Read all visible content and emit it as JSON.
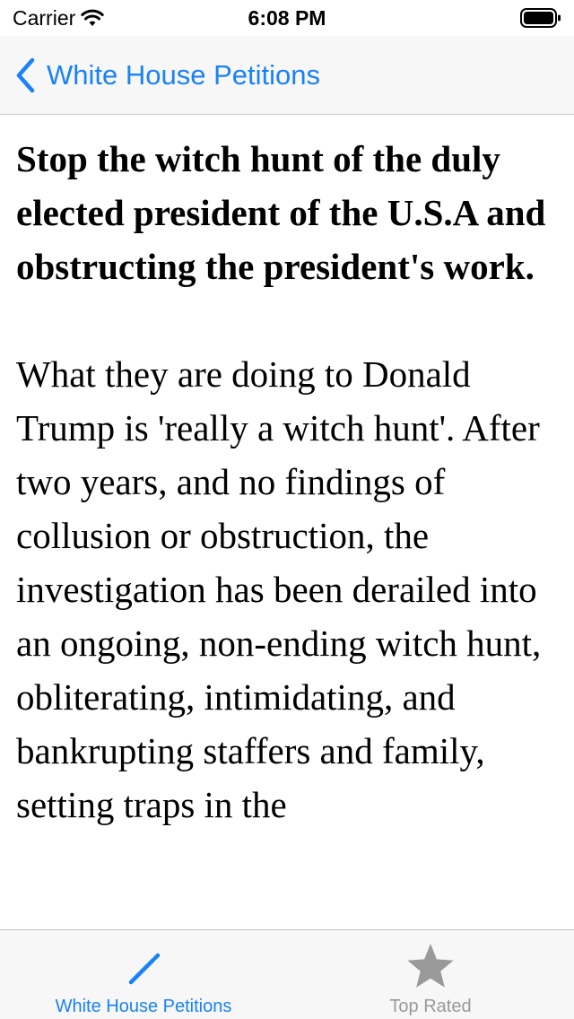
{
  "status_bar": {
    "carrier": "Carrier",
    "time": "6:08 PM",
    "wifi_icon": "wifi-icon",
    "battery_icon": "battery-icon"
  },
  "nav": {
    "back_icon": "chevron-left-icon",
    "back_label": "White House Petitions"
  },
  "petition": {
    "title": "Stop the witch hunt of the duly elected president of the U.S.A and obstructing the president's work.",
    "body": "What they are doing to Donald Trump is 'really a witch hunt'. After two years, and no findings of collusion or obstruction, the investigation has been derailed into an ongoing, non-ending witch hunt, obliterating, intimidating, and bankrupting staffers and family, setting traps in the"
  },
  "tab_bar": {
    "tabs": [
      {
        "label": "White House Petitions",
        "icon": "pencil-icon",
        "active": true
      },
      {
        "label": "Top Rated",
        "icon": "star-icon",
        "active": false
      }
    ]
  },
  "colors": {
    "accent": "#1a82f7",
    "inactive": "#999999",
    "bar_background": "#f7f7f7"
  }
}
